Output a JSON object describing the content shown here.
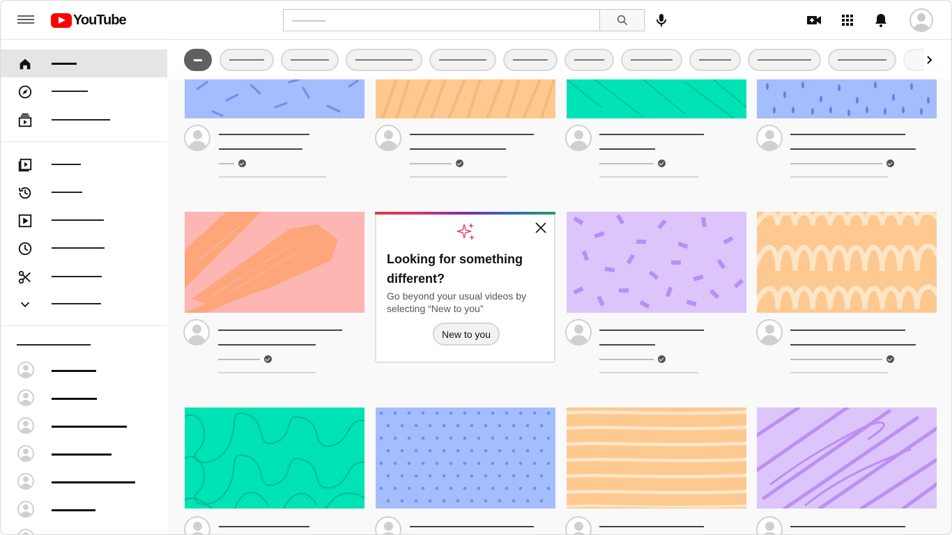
{
  "header": {
    "logo_text": "YouTube"
  },
  "popup": {
    "title": "Looking for something different?",
    "description": "Go beyond your usual videos by selecting “New to you”",
    "button_label": "New to you"
  },
  "colors": {
    "brand_red": "#ff0000",
    "blue_thumb": "#a4bdfc",
    "orange_thumb": "#fec891",
    "teal_thumb": "#00e3b5",
    "purple_thumb": "#dcc5fb",
    "pink_thumb": "#fdb6b3"
  },
  "icons": [
    "menu-icon",
    "search-icon",
    "mic-icon",
    "create-video-icon",
    "apps-icon",
    "notifications-icon",
    "home-icon",
    "explore-icon",
    "subscriptions-icon",
    "library-icon",
    "history-icon",
    "your-videos-icon",
    "watch-later-icon",
    "clips-icon",
    "show-more-icon",
    "close-icon",
    "sparkle-icon",
    "chevron-right-icon"
  ]
}
